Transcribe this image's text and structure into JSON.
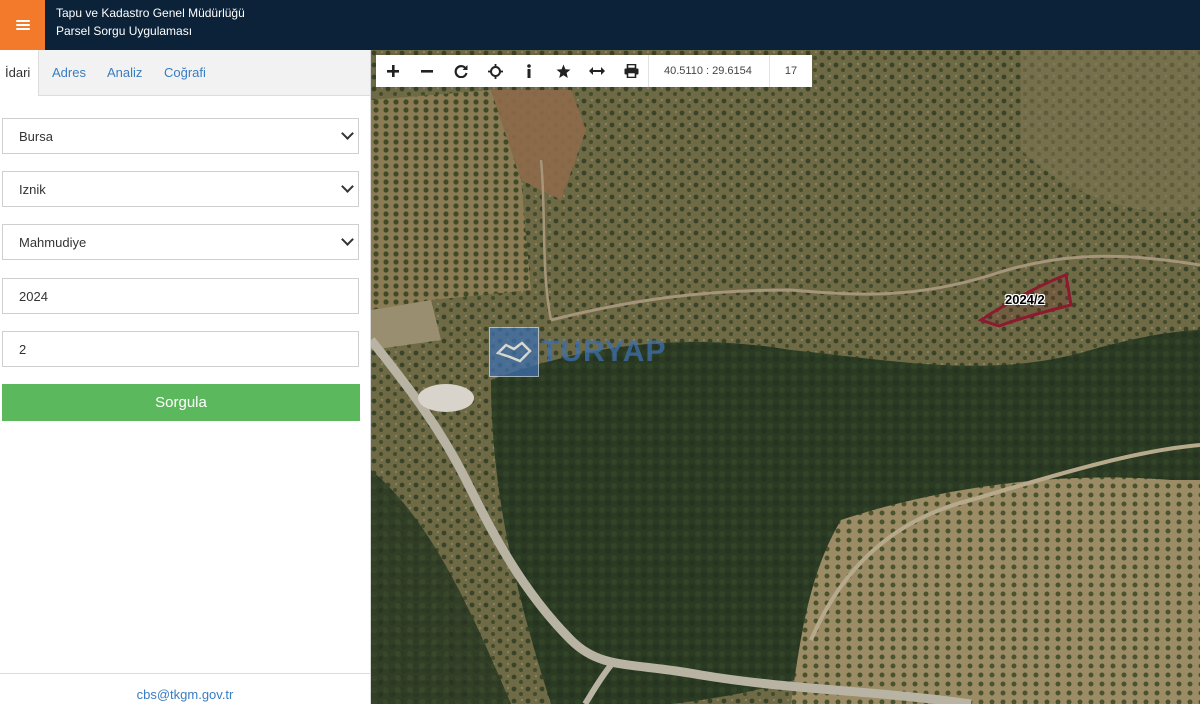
{
  "header": {
    "title_line1": "Tapu ve Kadastro Genel Müdürlüğü",
    "title_line2": "Parsel Sorgu Uygulaması",
    "menu_icon": "hamburger-icon",
    "accent_color": "#f37a2b",
    "bar_color": "#0b2238"
  },
  "tabs": [
    {
      "label": "İdari",
      "active": true
    },
    {
      "label": "Adres",
      "active": false
    },
    {
      "label": "Analiz",
      "active": false
    },
    {
      "label": "Coğrafi",
      "active": false
    }
  ],
  "form": {
    "province": "Bursa",
    "district": "Iznik",
    "neighborhood": "Mahmudiye",
    "block_no": "2024",
    "parcel_no": "2",
    "submit_label": "Sorgula",
    "submit_color": "#5cb85c"
  },
  "footer": {
    "email": "cbs@tkgm.gov.tr"
  },
  "map": {
    "toolbar_icons": [
      "zoom-in-icon",
      "zoom-out-icon",
      "refresh-icon",
      "locate-icon",
      "info-icon",
      "favorite-star-icon",
      "measure-icon",
      "print-icon"
    ],
    "coordinates": "40.5110 : 29.6154",
    "zoom_level": "17",
    "parcel_label": "2024/2",
    "watermark_text": "TURYAP"
  }
}
